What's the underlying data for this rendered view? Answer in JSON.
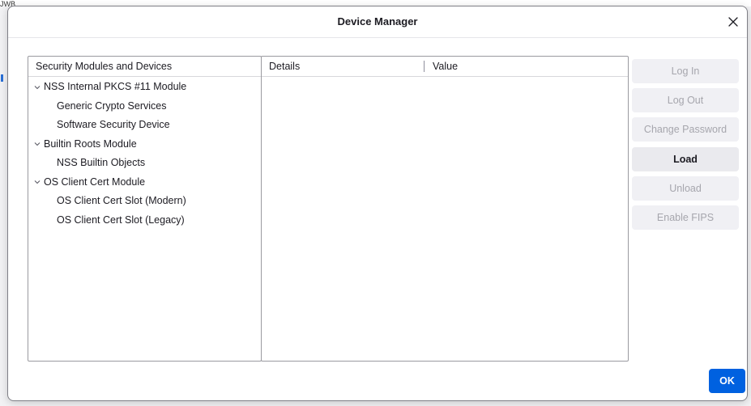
{
  "background": {
    "snippet": "JWB"
  },
  "dialog": {
    "title": "Device Manager",
    "close_icon": "close-icon"
  },
  "modules_panel": {
    "header": "Security Modules and Devices",
    "modules": [
      {
        "label": "NSS Internal PKCS #11 Module",
        "expanded": true,
        "devices": [
          "Generic Crypto Services",
          "Software Security Device"
        ]
      },
      {
        "label": "Builtin Roots Module",
        "expanded": true,
        "devices": [
          "NSS Builtin Objects"
        ]
      },
      {
        "label": "OS Client Cert Module",
        "expanded": true,
        "devices": [
          "OS Client Cert Slot (Modern)",
          "OS Client Cert Slot (Legacy)"
        ]
      }
    ]
  },
  "details_panel": {
    "col_details": "Details",
    "col_value": "Value"
  },
  "actions": {
    "log_in": "Log In",
    "log_out": "Log Out",
    "change_password": "Change Password",
    "load": "Load",
    "unload": "Unload",
    "enable_fips": "Enable FIPS"
  },
  "footer": {
    "ok": "OK"
  },
  "colors": {
    "accent": "#0061e0",
    "disabled_text": "#a6a6ad",
    "button_bg": "#f0f0f4"
  }
}
